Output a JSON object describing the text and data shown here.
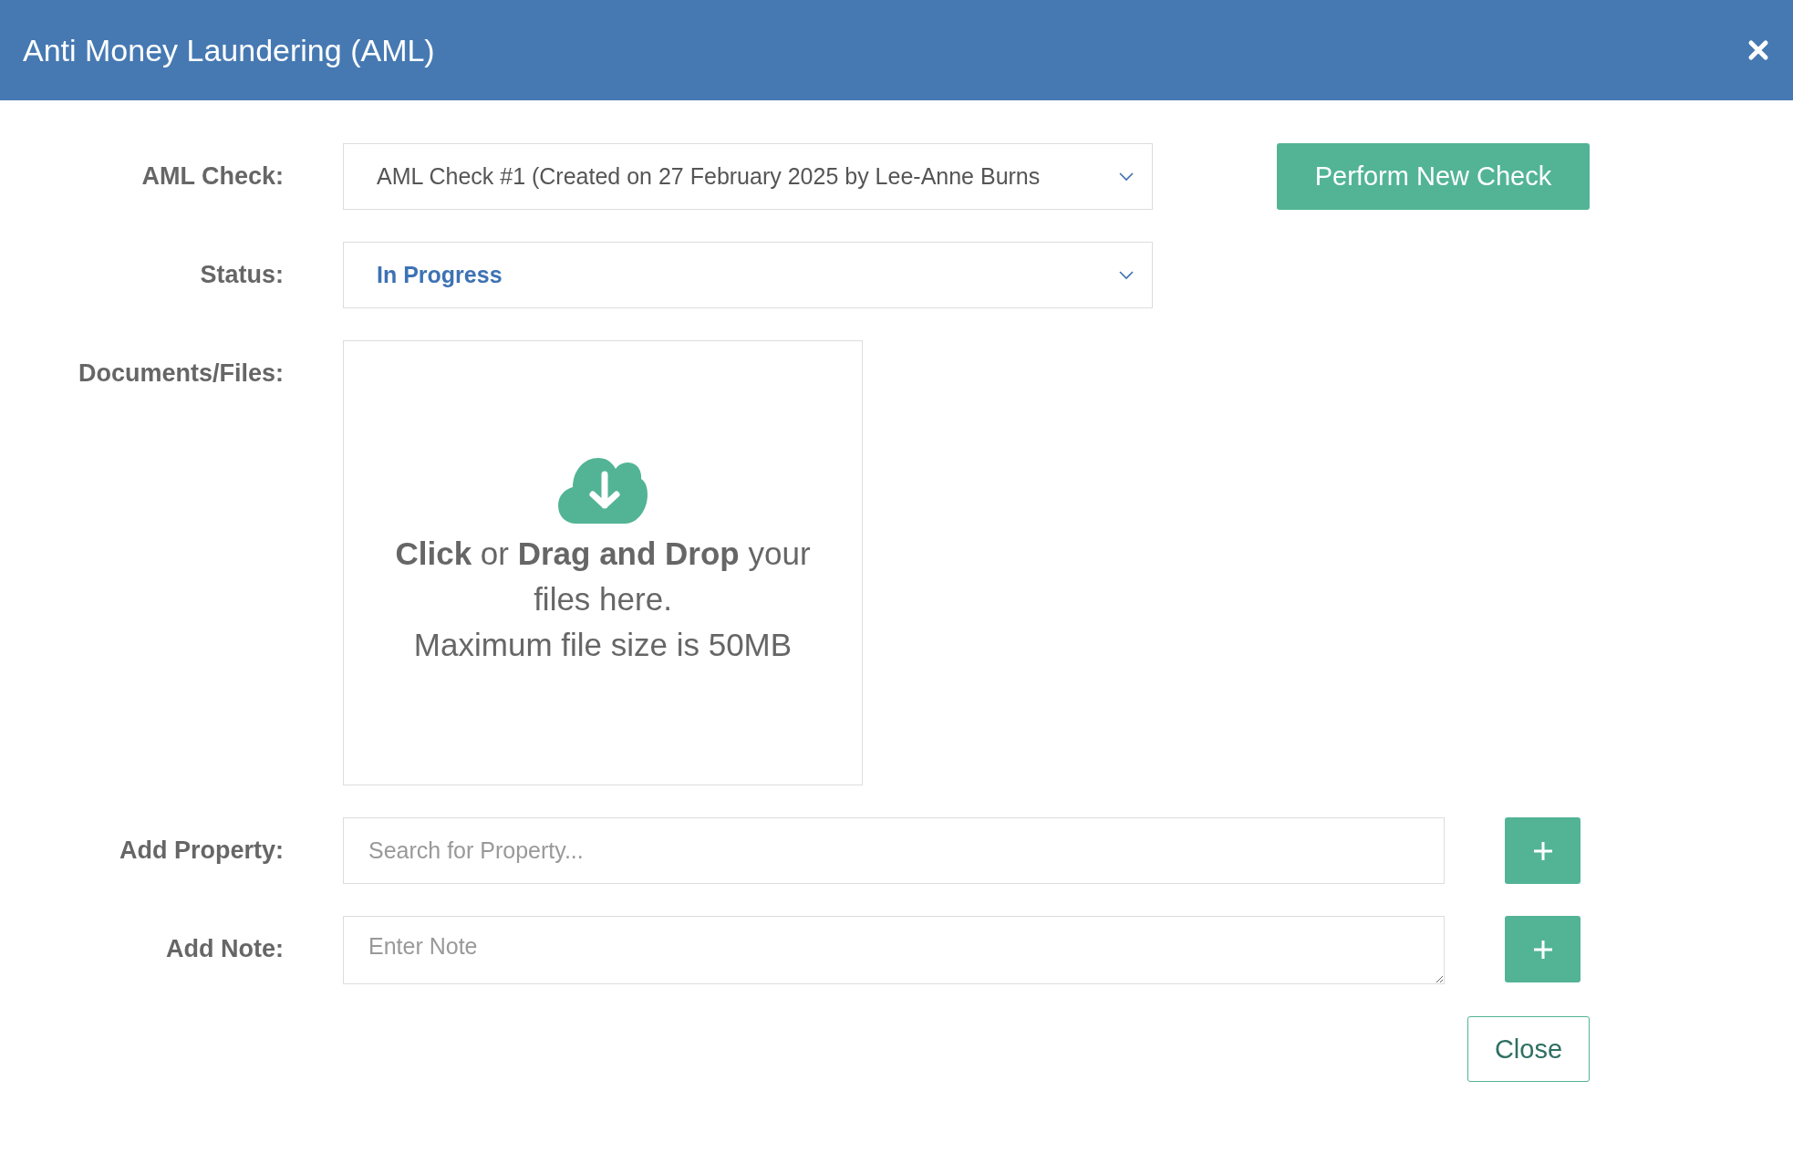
{
  "dialog": {
    "title": "Anti Money Laundering (AML)"
  },
  "fields": [
    {
      "kind": "select",
      "label": "AML Check:",
      "value": "AML Check #1 (Created on 27 February 2025 by Lee-Anne Burns",
      "action": "Perform New Check"
    },
    {
      "kind": "status",
      "label": "Status:",
      "value": "In Progress"
    },
    {
      "kind": "upload",
      "label": "Documents/Files:",
      "instructions": "**Click** or **Drag and Drop** your files here.",
      "limit": "Maximum file size is 50MB"
    },
    {
      "kind": "search",
      "label": "Add Property:",
      "placeholder": "Search for Property..."
    },
    {
      "kind": "note",
      "label": "Add Note:",
      "placeholder": "Enter Note"
    }
  ],
  "buttons": [
    "Close"
  ]
}
